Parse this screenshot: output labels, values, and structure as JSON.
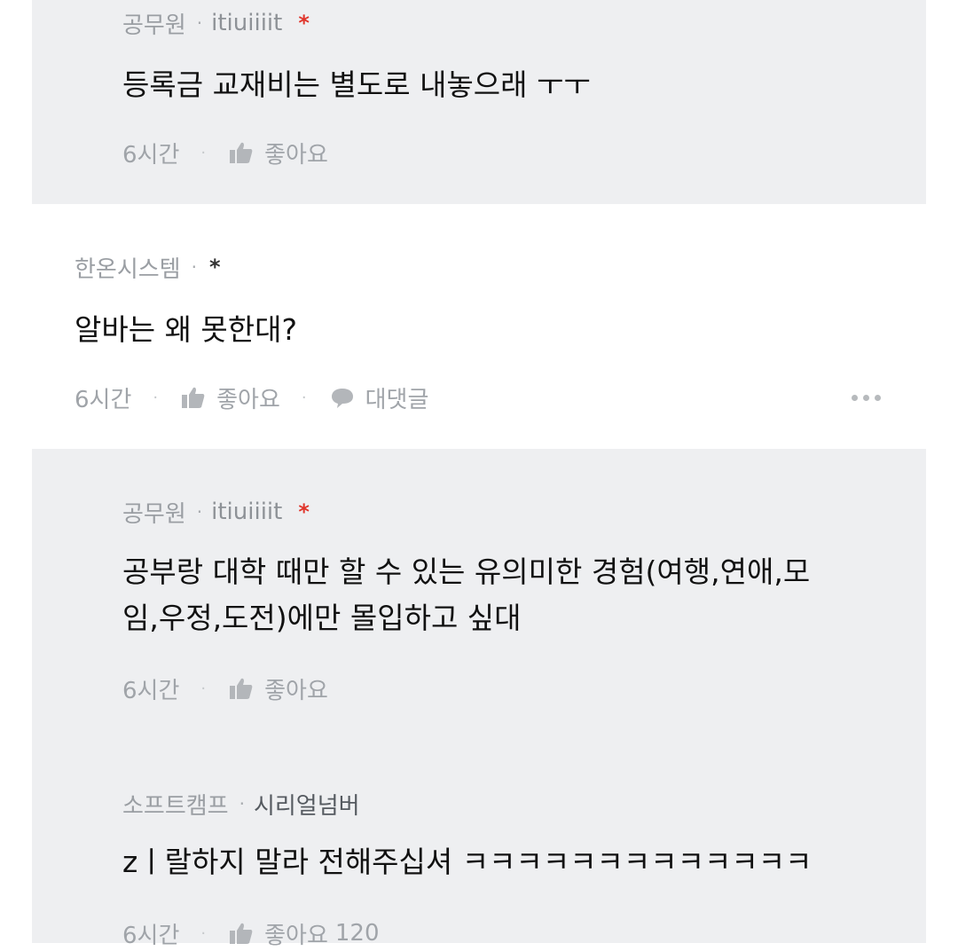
{
  "comments": [
    {
      "author": "공무원",
      "handle": "itiuiiiit",
      "star": "*",
      "text_lines": [
        "등록금 교재비는 별도로 내놓으래 ㅜㅜ"
      ],
      "time": "6시간",
      "like_label": "좋아요"
    },
    {
      "author": "한온시스템",
      "star": "*",
      "text_lines": [
        "알바는 왜 못한대?"
      ],
      "time": "6시간",
      "like_label": "좋아요",
      "reply_label": "대댓글"
    },
    {
      "author": "공무원",
      "handle": "itiuiiiit",
      "star": "*",
      "text_lines": [
        "공부랑 대학 때만 할 수 있는 유의미한 경험(여행,연애,모",
        "임,우정,도전)에만 몰입하고 싶대"
      ],
      "time": "6시간",
      "like_label": "좋아요"
    },
    {
      "author": "소프트캠프",
      "handle": "시리얼넘버",
      "text_lines": [
        "zㅣ랄하지 말라 전해주십셔 ㅋㅋㅋㅋㅋㅋㅋㅋㅋㅋㅋㅋㅋ"
      ],
      "time": "6시간",
      "like_label": "좋아요",
      "like_count": "120"
    }
  ],
  "icons": {
    "like": "thumbs-up-icon",
    "reply": "speech-bubble-icon",
    "more": "more-dots-icon"
  },
  "colors": {
    "reply_background": "#eeeff1",
    "meta_text": "#9a9ea3",
    "star_accent": "#e0352b"
  }
}
